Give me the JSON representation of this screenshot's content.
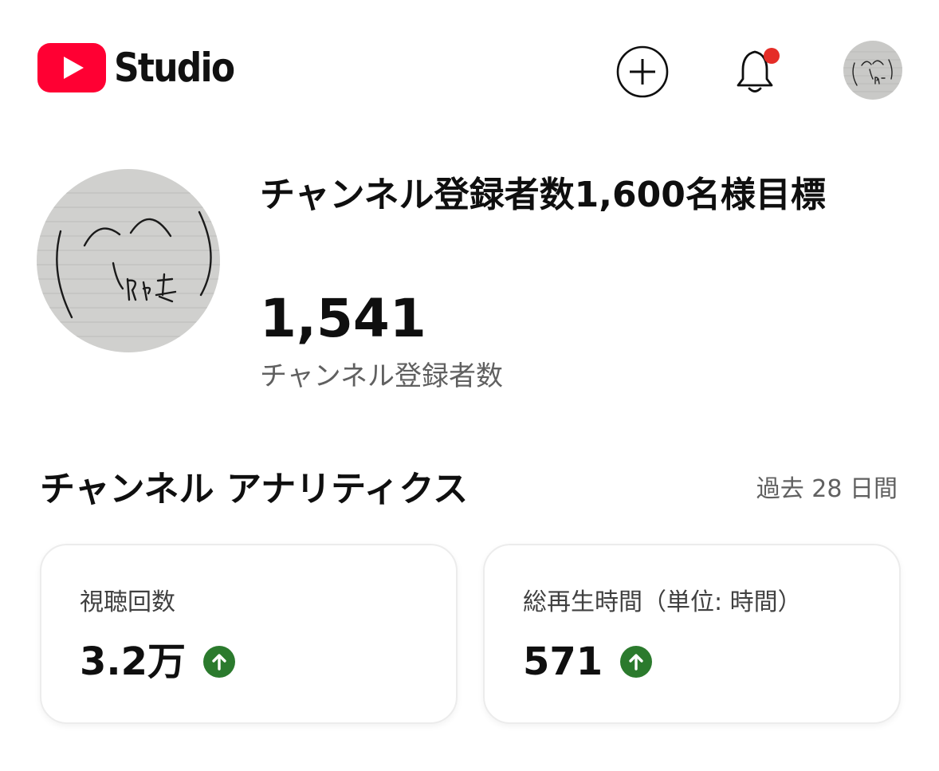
{
  "header": {
    "logo_text": "Studio",
    "brand_color": "#ff0000",
    "notification_dot_color": "#e52d27",
    "icons": [
      "youtube-logo-icon",
      "create-plus-icon",
      "notification-bell-icon",
      "account-avatar"
    ]
  },
  "channel": {
    "goal_title": "チャンネル登録者数1,600名様目標",
    "subscriber_count": "1,541",
    "subscriber_label": "チャンネル登録者数"
  },
  "analytics": {
    "title": "チャンネル アナリティクス",
    "period": "過去 28 日間",
    "cards": [
      {
        "label": "視聴回数",
        "value": "3.2万",
        "trend": "up"
      },
      {
        "label": "総再生時間（単位: 時間）",
        "value": "571",
        "trend": "up"
      }
    ],
    "trend_up_color": "#2b7a2d"
  }
}
